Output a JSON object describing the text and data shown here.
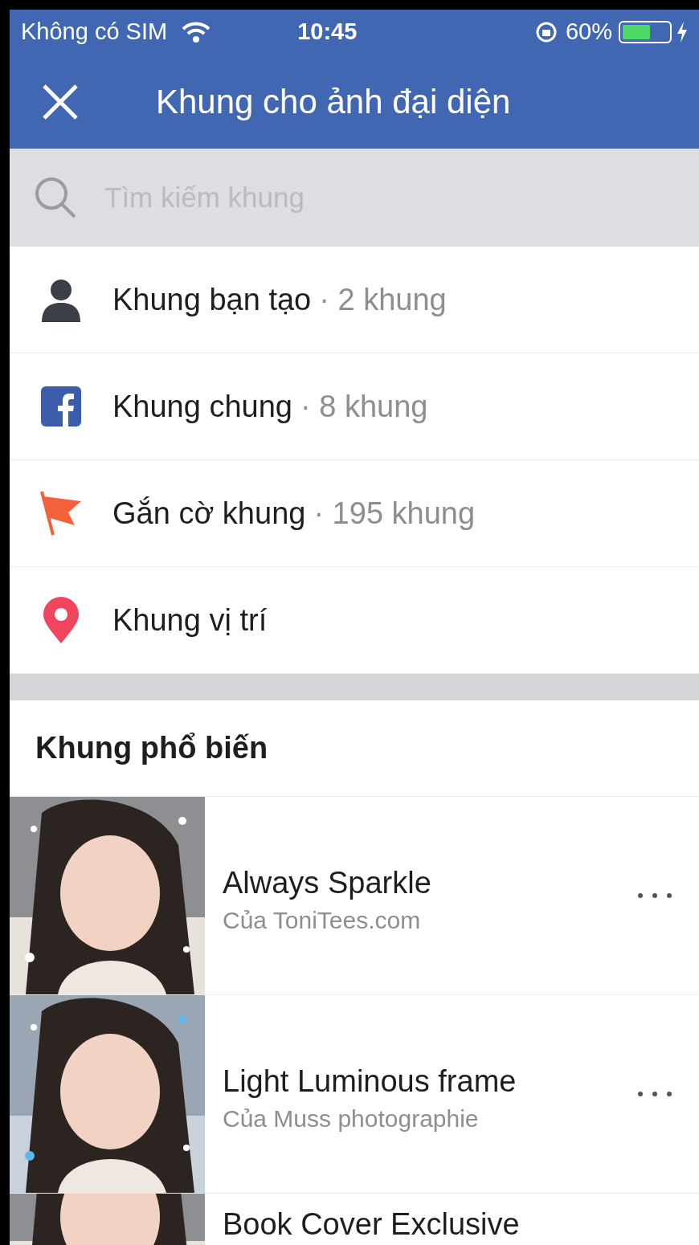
{
  "status_bar": {
    "carrier": "Không có SIM",
    "time": "10:45",
    "battery": "60%"
  },
  "header": {
    "title": "Khung cho ảnh đại diện"
  },
  "search": {
    "placeholder": "Tìm kiếm khung"
  },
  "categories": [
    {
      "kind": "person",
      "name": "Khung bạn tạo",
      "count": "· 2 khung"
    },
    {
      "kind": "facebook",
      "name": "Khung chung",
      "count": "· 8 khung"
    },
    {
      "kind": "flag",
      "name": "Gắn cờ khung",
      "count": "· 195 khung"
    },
    {
      "kind": "pin",
      "name": "Khung vị trí"
    }
  ],
  "section_title": "Khung phổ biến",
  "frames": [
    {
      "title": "Always Sparkle",
      "author": "Của ToniTees.com"
    },
    {
      "title": "Light Luminous frame",
      "author": "Của Muss photographie"
    },
    {
      "title": "Book Cover Exclusive"
    }
  ]
}
